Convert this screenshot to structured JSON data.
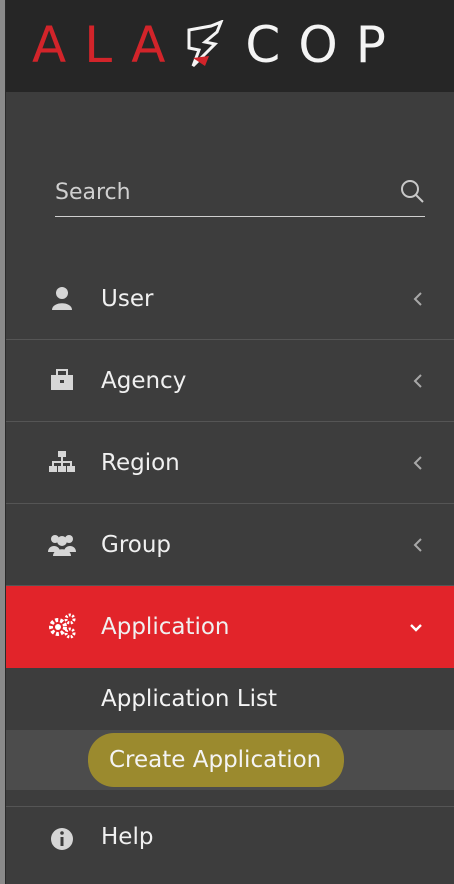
{
  "brand": {
    "part1": "ALA",
    "part2": "COP"
  },
  "search": {
    "placeholder": "Search",
    "value": ""
  },
  "menu": {
    "user": "User",
    "agency": "Agency",
    "region": "Region",
    "group": "Group",
    "application": "Application",
    "help": "Help"
  },
  "submenu": {
    "list": "Application List",
    "create": "Create Application"
  },
  "colors": {
    "active": "#e2242a",
    "highlight": "#9b8a2e",
    "sidebar": "#3d3d3d",
    "header": "#262626"
  }
}
